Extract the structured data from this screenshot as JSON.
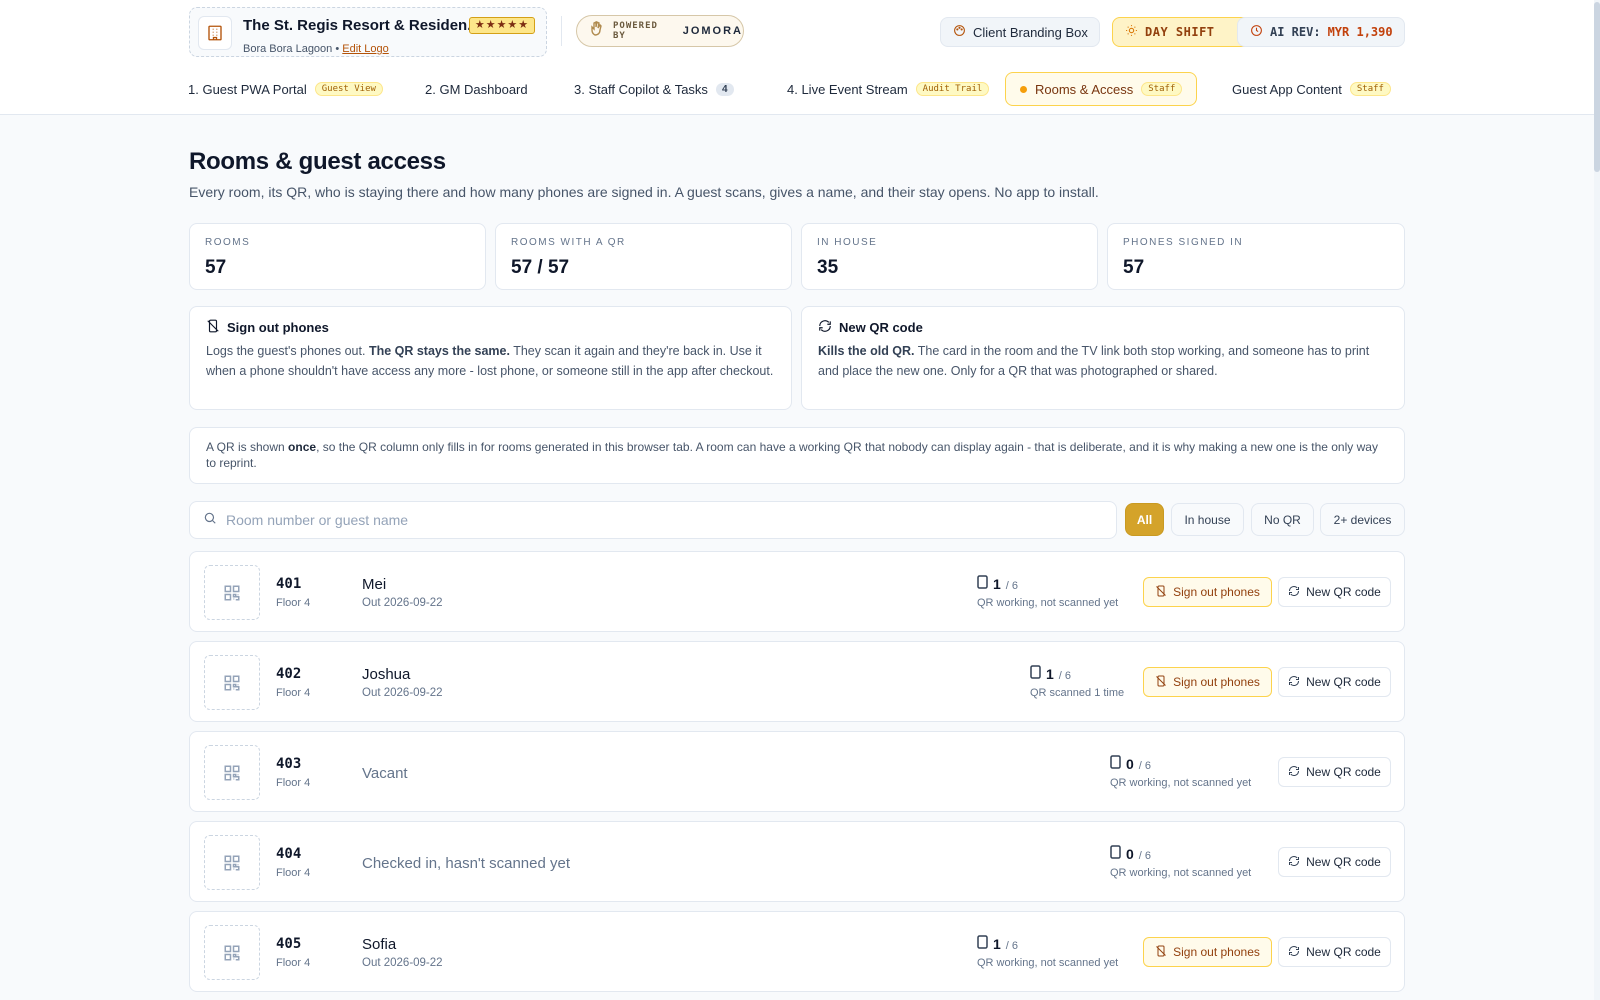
{
  "header": {
    "brand_name": "The St. Regis Resort & Residen...",
    "stars": "★★★★★",
    "brand_location": "Bora Bora Lagoon •",
    "edit_logo": "Edit Logo",
    "powered_by": "POWERED BY",
    "powered_brand": "JOMORA",
    "client_branding": "Client Branding Box",
    "shift": "DAY SHIFT",
    "ai_rev_label": "AI REV:",
    "ai_rev_value": "MYR 1,390"
  },
  "tabs": [
    {
      "label": "1. Guest PWA Portal",
      "tag": "Guest View"
    },
    {
      "label": "2. GM Dashboard"
    },
    {
      "label": "3. Staff Copilot & Tasks",
      "badge": "4"
    },
    {
      "label": "4. Live Event Stream",
      "tag": "Audit Trail"
    },
    {
      "label": "Rooms & Access",
      "tag": "Staff",
      "active": true
    },
    {
      "label": "Guest App Content",
      "tag": "Staff"
    }
  ],
  "page": {
    "title": "Rooms & guest access",
    "subtitle": "Every room, its QR, who is staying there and how many phones are signed in. A guest scans, gives a name, and their stay opens. No app to install."
  },
  "stats": [
    {
      "label": "ROOMS",
      "value": "57"
    },
    {
      "label": "ROOMS WITH A QR",
      "value": "57 / 57"
    },
    {
      "label": "IN HOUSE",
      "value": "35"
    },
    {
      "label": "PHONES SIGNED IN",
      "value": "57"
    }
  ],
  "info": {
    "signout": {
      "title": "Sign out phones",
      "lead": "Logs the guest's phones out.",
      "bold": "The QR stays the same.",
      "rest": "They scan it again and they're back in. Use it when a phone shouldn't have access any more - lost phone, or someone still in the app after checkout."
    },
    "newqr": {
      "title": "New QR code",
      "bold": "Kills the old QR.",
      "rest": "The card in the room and the TV link both stop working, and someone has to print and place the new one. Only for a QR that was photographed or shared."
    }
  },
  "note": {
    "pre": "A QR is shown",
    "bold": "once",
    "post": ", so the QR column only fills in for rooms generated in this browser tab. A room can have a working QR that nobody can display again - that is deliberate, and it is why making a new one is the only way to reprint."
  },
  "search": {
    "placeholder": "Room number or guest name",
    "value": ""
  },
  "filters": [
    "All",
    "In house",
    "No QR",
    "2+ devices"
  ],
  "actions": {
    "sign_out": "Sign out phones",
    "new_qr": "New QR code"
  },
  "rooms": [
    {
      "number": "401",
      "floor": "Floor 4",
      "guest": "Mei",
      "checkout": "Out 2026-09-22",
      "devices": "1",
      "max": "/ 6",
      "status": "QR working, not scanned yet"
    },
    {
      "number": "402",
      "floor": "Floor 4",
      "guest": "Joshua",
      "checkout": "Out 2026-09-22",
      "devices": "1",
      "max": "/ 6",
      "status": "QR scanned 1 time"
    },
    {
      "number": "403",
      "floor": "Floor 4",
      "guest": "Vacant",
      "devices": "0",
      "max": "/ 6",
      "status": "QR working, not scanned yet"
    },
    {
      "number": "404",
      "floor": "Floor 4",
      "guest": "Checked in, hasn't scanned yet",
      "devices": "0",
      "max": "/ 6",
      "status": "QR working, not scanned yet"
    },
    {
      "number": "405",
      "floor": "Floor 4",
      "guest": "Sofia",
      "checkout": "Out 2026-09-22",
      "devices": "1",
      "max": "/ 6",
      "status": "QR working, not scanned yet"
    }
  ]
}
